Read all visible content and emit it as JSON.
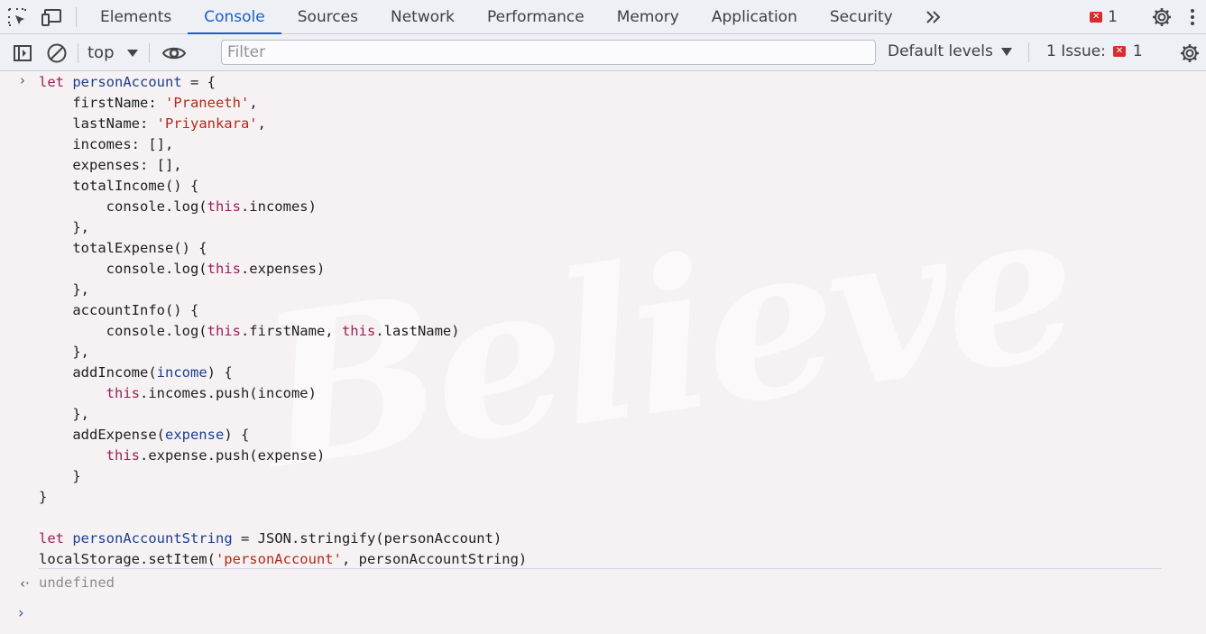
{
  "tabs": [
    "Elements",
    "Console",
    "Sources",
    "Network",
    "Performance",
    "Memory",
    "Application",
    "Security"
  ],
  "active_tab": "Console",
  "error_count": "1",
  "toolbar": {
    "context": "top",
    "filter_placeholder": "Filter",
    "levels": "Default levels",
    "issues_label": "1 Issue:",
    "issues_count": "1"
  },
  "code_lines": [
    "let personAccount = {",
    "    firstName: 'Praneeth',",
    "    lastName: 'Priyankara',",
    "    incomes: [],",
    "    expenses: [],",
    "    totalIncome() {",
    "        console.log(this.incomes)",
    "    },",
    "    totalExpense() {",
    "        console.log(this.expenses)",
    "    },",
    "    accountInfo() {",
    "        console.log(this.firstName, this.lastName)",
    "    },",
    "    addIncome(income) {",
    "        this.incomes.push(income)",
    "    },",
    "    addExpense(expense) {",
    "        this.expense.push(expense)",
    "    }",
    "}",
    "",
    "let personAccountString = JSON.stringify(personAccount)",
    "localStorage.setItem('personAccount', personAccountString)"
  ],
  "result": "undefined",
  "watermark": "Believe",
  "colors": {
    "accent": "#1a5fc7",
    "keyword": "#9c1e57",
    "string": "#b32a19",
    "error": "#d72d2d"
  }
}
